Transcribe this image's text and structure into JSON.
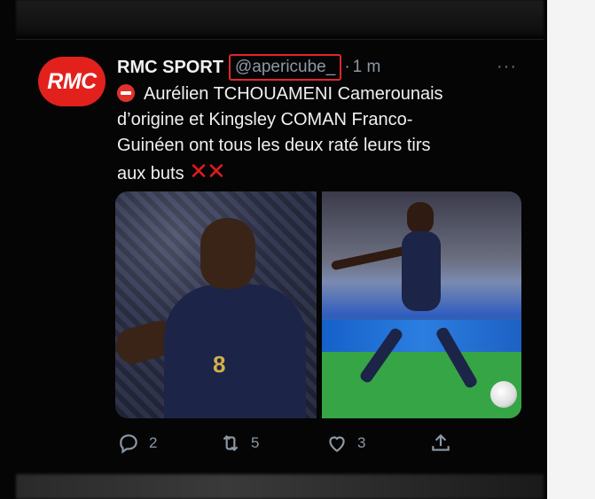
{
  "tweet": {
    "avatar_text": "RMC",
    "author": "RMC SPORT",
    "handle": "@apericube_",
    "separator": "·",
    "time": "1 m",
    "more": "···",
    "text_line1": "Aurélien TCHOUAMENI Camerounais",
    "text_line2": "d’origine et Kingsley COMAN Franco-",
    "text_line3": "Guinéen  ont tous les deux raté leurs tirs",
    "text_line4": "aux buts",
    "emoji_x": "✕✕",
    "left_shirt_number": "8"
  },
  "actions": {
    "reply_count": "2",
    "retweet_count": "5",
    "like_count": "3"
  },
  "colors": {
    "brand_red": "#e2211c",
    "highlight_box": "#e3262a",
    "muted_text": "#8b98a5",
    "background": "#050505"
  },
  "icons": {
    "stop": "stop-sign-icon",
    "reply": "reply-icon",
    "retweet": "retweet-icon",
    "like": "heart-icon",
    "share": "share-icon"
  }
}
